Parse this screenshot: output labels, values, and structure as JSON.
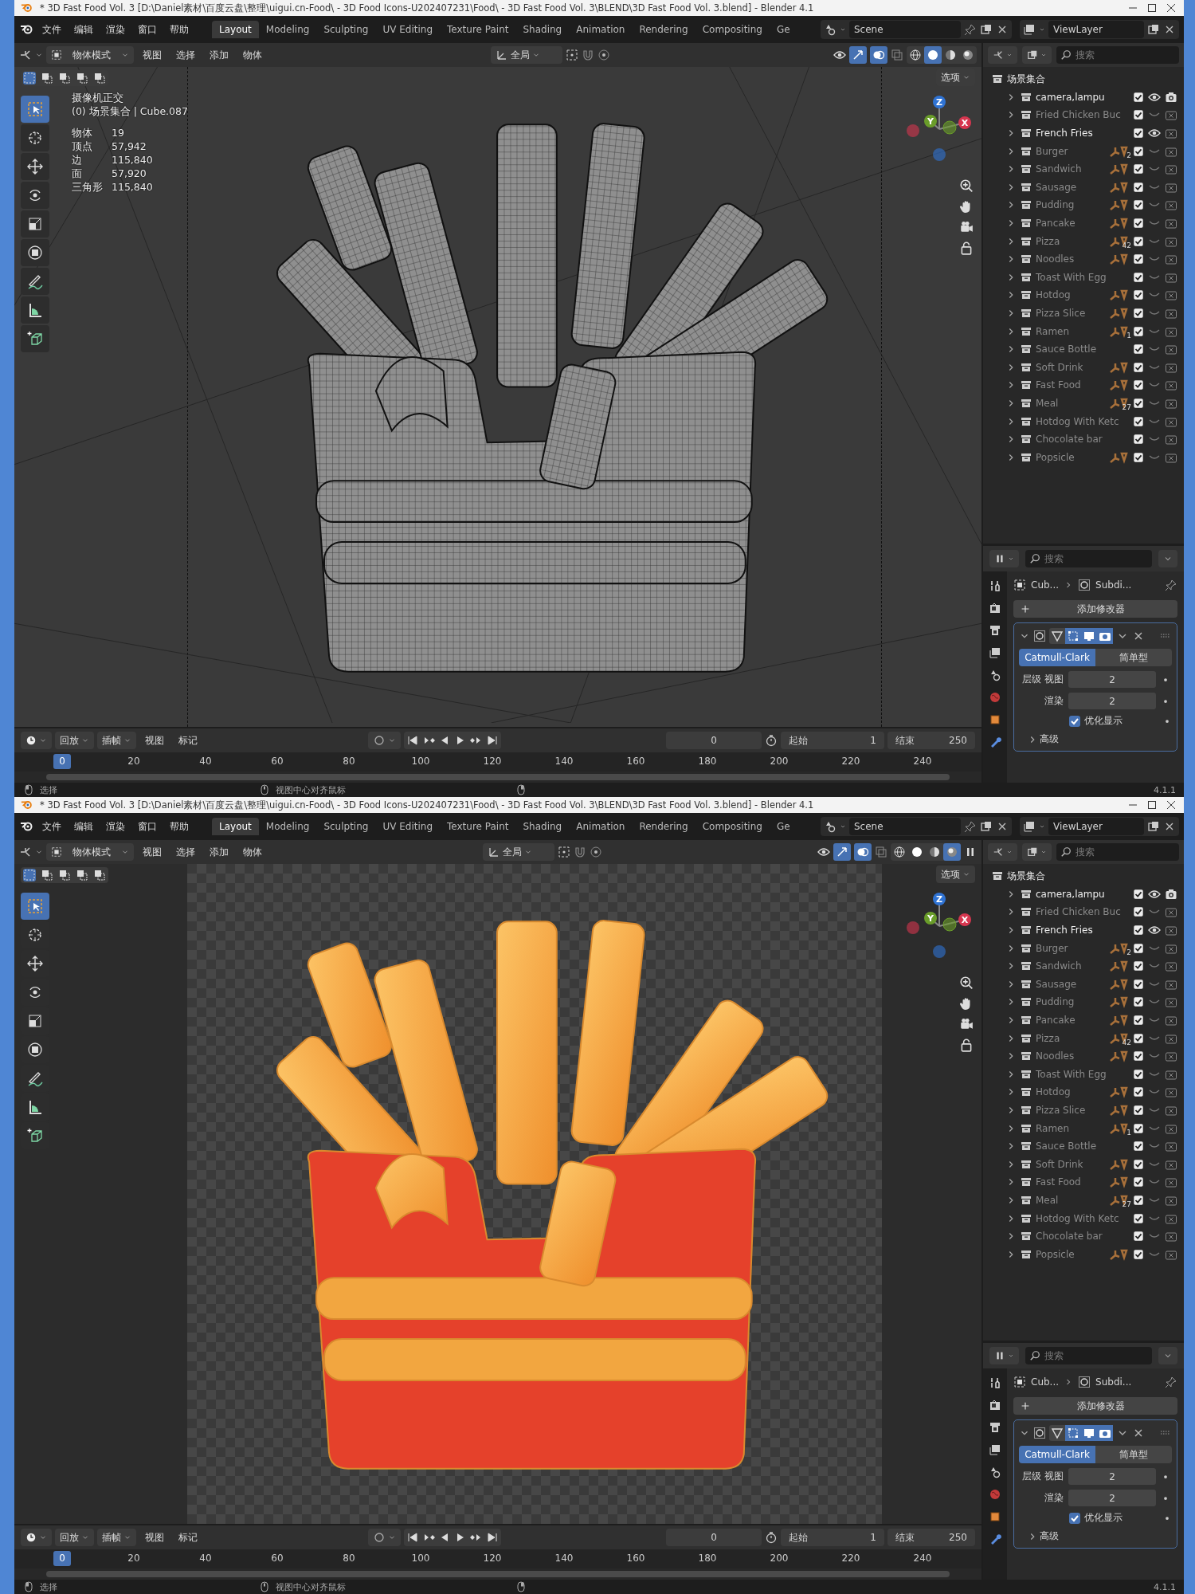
{
  "windows": [
    {
      "title": "* 3D Fast Food Vol. 3 [D:\\Daniel素材\\百度云盘\\整理\\uigui.cn-Food\\ - 3D Food Icons-U202407231\\Food\\ - 3D Fast Food Vol. 3\\BLEND\\3D Fast Food Vol. 3.blend] - Blender 4.1",
      "menus": [
        "文件",
        "编辑",
        "渲染",
        "窗口",
        "帮助"
      ],
      "workspaces": [
        {
          "label": "Layout",
          "selected": true
        },
        {
          "label": "Modeling",
          "selected": false
        },
        {
          "label": "Sculpting",
          "selected": false
        },
        {
          "label": "UV Editing",
          "selected": false
        },
        {
          "label": "Texture Paint",
          "selected": false
        },
        {
          "label": "Shading",
          "selected": false
        },
        {
          "label": "Animation",
          "selected": false
        },
        {
          "label": "Rendering",
          "selected": false
        },
        {
          "label": "Compositing",
          "selected": false
        },
        {
          "label": "Ge",
          "selected": false
        }
      ],
      "scene": "Scene",
      "view_layer": "ViewLayer",
      "header": {
        "mode": "物体模式",
        "menus": [
          "视图",
          "选择",
          "添加",
          "物体"
        ],
        "orientation": "全局",
        "shading": [
          {
            "selected": false
          },
          {
            "selected": true
          },
          {
            "selected": false
          },
          {
            "selected": false
          }
        ],
        "options": "选项"
      },
      "tools": [
        {
          "selected": true
        },
        {
          "selected": false
        },
        {
          "selected": false
        },
        {
          "selected": false
        },
        {
          "selected": false
        },
        {
          "selected": false
        },
        {
          "selected": false
        },
        {
          "selected": false
        },
        {
          "selected": false
        }
      ],
      "viewport": {
        "kind": "wireframe",
        "axes": [
          "Z",
          "Y",
          "X"
        ],
        "overlay": {
          "view": "摄像机正交",
          "context": "(0) 场景集合 | Cube.087",
          "stats": [
            {
              "label": "物体",
              "value": "19"
            },
            {
              "label": "顶点",
              "value": "57,942"
            },
            {
              "label": "边",
              "value": "115,840"
            },
            {
              "label": "面",
              "value": "57,920"
            },
            {
              "label": "三角形",
              "value": "115,840"
            }
          ]
        }
      },
      "timeline": {
        "menus": [
          "回放",
          "插帧",
          "视图",
          "标记"
        ],
        "current_frame": "0",
        "start_label": "起始",
        "start": "1",
        "end_label": "结束",
        "end": "250",
        "ticks": [
          "20",
          "40",
          "60",
          "80",
          "100",
          "120",
          "140",
          "160",
          "180",
          "200",
          "220",
          "240"
        ],
        "playhead": "0",
        "level": 0
      },
      "outliner": {
        "placeholder": "搜索",
        "root": "场景集合",
        "items": [
          {
            "name": "camera,lampu",
            "expanded": false,
            "visible": true,
            "renderable": true,
            "checked": true,
            "data_icons": false
          },
          {
            "name": "Fried Chicken Buc",
            "expanded": false,
            "visible": false,
            "renderable": false,
            "checked": true,
            "data_icons": false
          },
          {
            "name": "French Fries",
            "expanded": false,
            "visible": true,
            "renderable": false,
            "checked": true,
            "data_icons": false
          },
          {
            "name": "Burger",
            "expanded": false,
            "visible": false,
            "renderable": false,
            "checked": true,
            "data_icons": true,
            "badge": "2"
          },
          {
            "name": "Sandwich",
            "expanded": false,
            "visible": false,
            "renderable": false,
            "checked": true,
            "data_icons": true
          },
          {
            "name": "Sausage",
            "expanded": false,
            "visible": false,
            "renderable": false,
            "checked": true,
            "data_icons": true
          },
          {
            "name": "Pudding",
            "expanded": false,
            "visible": false,
            "renderable": false,
            "checked": true,
            "data_icons": true
          },
          {
            "name": "Pancake",
            "expanded": false,
            "visible": false,
            "renderable": false,
            "checked": true,
            "data_icons": true
          },
          {
            "name": "Pizza",
            "expanded": false,
            "visible": false,
            "renderable": false,
            "checked": true,
            "data_icons": true,
            "badge": "42"
          },
          {
            "name": "Noodles",
            "expanded": false,
            "visible": false,
            "renderable": false,
            "checked": true,
            "data_icons": true
          },
          {
            "name": "Toast With Egg",
            "expanded": false,
            "visible": false,
            "renderable": false,
            "checked": true,
            "data_icons": false
          },
          {
            "name": "Hotdog",
            "expanded": false,
            "visible": false,
            "renderable": false,
            "checked": true,
            "data_icons": true
          },
          {
            "name": "Pizza Slice",
            "expanded": false,
            "visible": false,
            "renderable": false,
            "checked": true,
            "data_icons": true
          },
          {
            "name": "Ramen",
            "expanded": false,
            "visible": false,
            "renderable": false,
            "checked": true,
            "data_icons": true,
            "badge": "1"
          },
          {
            "name": "Sauce Bottle",
            "expanded": false,
            "visible": false,
            "renderable": false,
            "checked": true,
            "data_icons": false
          },
          {
            "name": "Soft Drink",
            "expanded": false,
            "visible": false,
            "renderable": false,
            "checked": true,
            "data_icons": true
          },
          {
            "name": "Fast Food",
            "expanded": false,
            "visible": false,
            "renderable": false,
            "checked": true,
            "data_icons": true
          },
          {
            "name": "Meal",
            "expanded": false,
            "visible": false,
            "renderable": false,
            "checked": true,
            "data_icons": true,
            "badge": "27"
          },
          {
            "name": "Hotdog With Ketc",
            "expanded": false,
            "visible": false,
            "renderable": false,
            "checked": true,
            "data_icons": false
          },
          {
            "name": "Chocolate bar",
            "expanded": false,
            "visible": false,
            "renderable": false,
            "checked": true,
            "data_icons": false
          },
          {
            "name": "Popsicle",
            "expanded": false,
            "visible": false,
            "renderable": false,
            "checked": true,
            "data_icons": true
          }
        ]
      },
      "properties": {
        "placeholder": "搜索",
        "breadcrumb": [
          "Cub...",
          "Subdi..."
        ],
        "add_button": "添加修改器",
        "toggles": [
          {
            "on": false
          },
          {
            "on": true
          },
          {
            "on": true
          },
          {
            "on": true
          }
        ],
        "types": [
          {
            "label": "Catmull-Clark",
            "selected": true
          },
          {
            "label": "简单型",
            "selected": false
          }
        ],
        "fields": [
          {
            "label": "层级 视图",
            "value": "2"
          },
          {
            "label": "渲染",
            "value": "2"
          }
        ],
        "optimize": {
          "label": "优化显示",
          "checked": true
        },
        "advanced": "高级"
      },
      "status": [
        "选择",
        "视图中心对齐鼠标"
      ],
      "version": "4.1.1"
    },
    {
      "title": "* 3D Fast Food Vol. 3 [D:\\Daniel素材\\百度云盘\\整理\\uigui.cn-Food\\ - 3D Food Icons-U202407231\\Food\\ - 3D Fast Food Vol. 3\\BLEND\\3D Fast Food Vol. 3.blend] - Blender 4.1",
      "menus": [
        "文件",
        "编辑",
        "渲染",
        "窗口",
        "帮助"
      ],
      "workspaces": [
        {
          "label": "Layout",
          "selected": true
        },
        {
          "label": "Modeling",
          "selected": false
        },
        {
          "label": "Sculpting",
          "selected": false
        },
        {
          "label": "UV Editing",
          "selected": false
        },
        {
          "label": "Texture Paint",
          "selected": false
        },
        {
          "label": "Shading",
          "selected": false
        },
        {
          "label": "Animation",
          "selected": false
        },
        {
          "label": "Rendering",
          "selected": false
        },
        {
          "label": "Compositing",
          "selected": false
        },
        {
          "label": "Ge",
          "selected": false
        }
      ],
      "scene": "Scene",
      "view_layer": "ViewLayer",
      "header": {
        "mode": "物体模式",
        "menus": [
          "视图",
          "选择",
          "添加",
          "物体"
        ],
        "orientation": "全局",
        "shading": [
          {
            "selected": false
          },
          {
            "selected": false
          },
          {
            "selected": false
          },
          {
            "selected": true
          }
        ],
        "options": "选项"
      },
      "tools": [
        {
          "selected": true
        },
        {
          "selected": false
        },
        {
          "selected": false
        },
        {
          "selected": false
        },
        {
          "selected": false
        },
        {
          "selected": false
        },
        {
          "selected": false
        },
        {
          "selected": false
        },
        {
          "selected": false
        }
      ],
      "viewport": {
        "kind": "rendered",
        "axes": [
          "Z",
          "Y",
          "X"
        ]
      },
      "timeline": {
        "menus": [
          "回放",
          "插帧",
          "视图",
          "标记"
        ],
        "current_frame": "0",
        "start_label": "起始",
        "start": "1",
        "end_label": "结束",
        "end": "250",
        "ticks": [
          "20",
          "40",
          "60",
          "80",
          "100",
          "120",
          "140",
          "160",
          "180",
          "200",
          "220",
          "240"
        ],
        "playhead": "0",
        "level": 0
      },
      "outliner": {
        "placeholder": "搜索",
        "root": "场景集合",
        "items": [
          {
            "name": "camera,lampu",
            "expanded": false,
            "visible": true,
            "renderable": true,
            "checked": true,
            "data_icons": false
          },
          {
            "name": "Fried Chicken Buc",
            "expanded": false,
            "visible": false,
            "renderable": false,
            "checked": true,
            "data_icons": false
          },
          {
            "name": "French Fries",
            "expanded": false,
            "visible": true,
            "renderable": false,
            "checked": true,
            "data_icons": false
          },
          {
            "name": "Burger",
            "expanded": false,
            "visible": false,
            "renderable": false,
            "checked": true,
            "data_icons": true,
            "badge": "2"
          },
          {
            "name": "Sandwich",
            "expanded": false,
            "visible": false,
            "renderable": false,
            "checked": true,
            "data_icons": true
          },
          {
            "name": "Sausage",
            "expanded": false,
            "visible": false,
            "renderable": false,
            "checked": true,
            "data_icons": true
          },
          {
            "name": "Pudding",
            "expanded": false,
            "visible": false,
            "renderable": false,
            "checked": true,
            "data_icons": true
          },
          {
            "name": "Pancake",
            "expanded": false,
            "visible": false,
            "renderable": false,
            "checked": true,
            "data_icons": true
          },
          {
            "name": "Pizza",
            "expanded": false,
            "visible": false,
            "renderable": false,
            "checked": true,
            "data_icons": true,
            "badge": "42"
          },
          {
            "name": "Noodles",
            "expanded": false,
            "visible": false,
            "renderable": false,
            "checked": true,
            "data_icons": true
          },
          {
            "name": "Toast With Egg",
            "expanded": false,
            "visible": false,
            "renderable": false,
            "checked": true,
            "data_icons": false
          },
          {
            "name": "Hotdog",
            "expanded": false,
            "visible": false,
            "renderable": false,
            "checked": true,
            "data_icons": true
          },
          {
            "name": "Pizza Slice",
            "expanded": false,
            "visible": false,
            "renderable": false,
            "checked": true,
            "data_icons": true
          },
          {
            "name": "Ramen",
            "expanded": false,
            "visible": false,
            "renderable": false,
            "checked": true,
            "data_icons": true,
            "badge": "1"
          },
          {
            "name": "Sauce Bottle",
            "expanded": false,
            "visible": false,
            "renderable": false,
            "checked": true,
            "data_icons": false
          },
          {
            "name": "Soft Drink",
            "expanded": false,
            "visible": false,
            "renderable": false,
            "checked": true,
            "data_icons": true
          },
          {
            "name": "Fast Food",
            "expanded": false,
            "visible": false,
            "renderable": false,
            "checked": true,
            "data_icons": true
          },
          {
            "name": "Meal",
            "expanded": false,
            "visible": false,
            "renderable": false,
            "checked": true,
            "data_icons": true,
            "badge": "27"
          },
          {
            "name": "Hotdog With Ketc",
            "expanded": false,
            "visible": false,
            "renderable": false,
            "checked": true,
            "data_icons": false
          },
          {
            "name": "Chocolate bar",
            "expanded": false,
            "visible": false,
            "renderable": false,
            "checked": true,
            "data_icons": false
          },
          {
            "name": "Popsicle",
            "expanded": false,
            "visible": false,
            "renderable": false,
            "checked": true,
            "data_icons": true
          }
        ]
      },
      "properties": {
        "placeholder": "搜索",
        "breadcrumb": [
          "Cub...",
          "Subdi..."
        ],
        "add_button": "添加修改器",
        "toggles": [
          {
            "on": false
          },
          {
            "on": true
          },
          {
            "on": true
          },
          {
            "on": true
          }
        ],
        "types": [
          {
            "label": "Catmull-Clark",
            "selected": true
          },
          {
            "label": "简单型",
            "selected": false
          }
        ],
        "fields": [
          {
            "label": "层级 视图",
            "value": "2"
          },
          {
            "label": "渲染",
            "value": "2"
          }
        ],
        "optimize": {
          "label": "优化显示",
          "checked": true
        },
        "advanced": "高级"
      },
      "status": [
        "选择",
        "视图中心对齐鼠标"
      ],
      "version": "4.1.1"
    }
  ]
}
